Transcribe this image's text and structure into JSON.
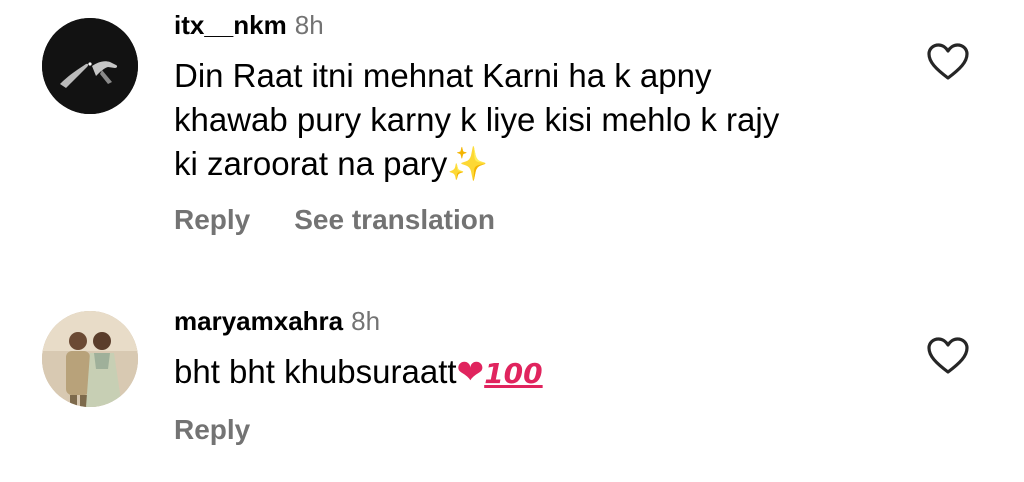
{
  "comments": [
    {
      "username": "itx__nkm",
      "time": "8h",
      "text_lines": [
        "Din Raat itni mehnat Karni ha k apny",
        "khawab pury karny k liye kisi mehlo k rajy",
        "ki zaroorat na pary"
      ],
      "emoji": "✨",
      "reply_label": "Reply",
      "translate_label": "See translation",
      "like_icon": "heart-outline-icon"
    },
    {
      "username": "maryamxahra",
      "time": "8h",
      "text": "bht bht khubsuraatt",
      "emoji_heart": "❤",
      "emoji_100": "100",
      "reply_label": "Reply",
      "like_icon": "heart-outline-icon"
    }
  ],
  "colors": {
    "text": "#000000",
    "secondary": "#737373",
    "background": "#ffffff"
  }
}
